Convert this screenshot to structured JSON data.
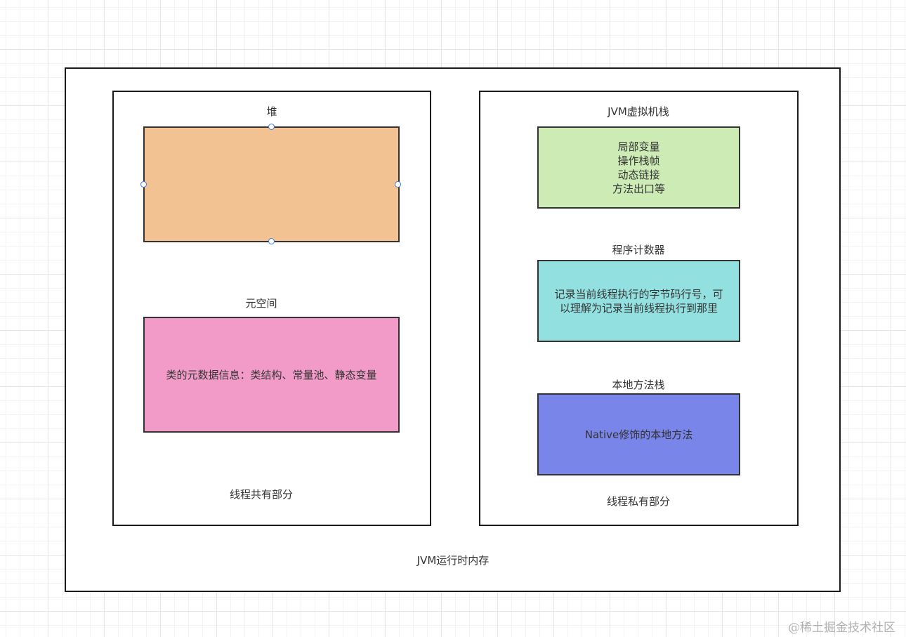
{
  "outer_title": "JVM运行时内存",
  "shared": {
    "caption": "线程共有部分",
    "heap": {
      "label": "堆",
      "text": "",
      "color": "#F2C292"
    },
    "metaspace": {
      "label": "元空间",
      "text": "类的元数据信息：类结构、常量池、静态变量",
      "color": "#F29BC8"
    }
  },
  "private": {
    "caption": "线程私有部分",
    "vm_stack": {
      "label": "JVM虚拟机栈",
      "lines": [
        "局部变量",
        "操作栈帧",
        "动态链接",
        "方法出口等"
      ],
      "color": "#CCEBB5"
    },
    "pc_register": {
      "label": "程序计数器",
      "lines": [
        "记录当前线程执行的字节码行号，可",
        "以理解为记录当前线程执行到那里"
      ],
      "color": "#93E0E0"
    },
    "native_stack": {
      "label": "本地方法栈",
      "text": "Native修饰的本地方法",
      "color": "#7A85EA"
    }
  },
  "watermark": "@稀土掘金技术社区"
}
